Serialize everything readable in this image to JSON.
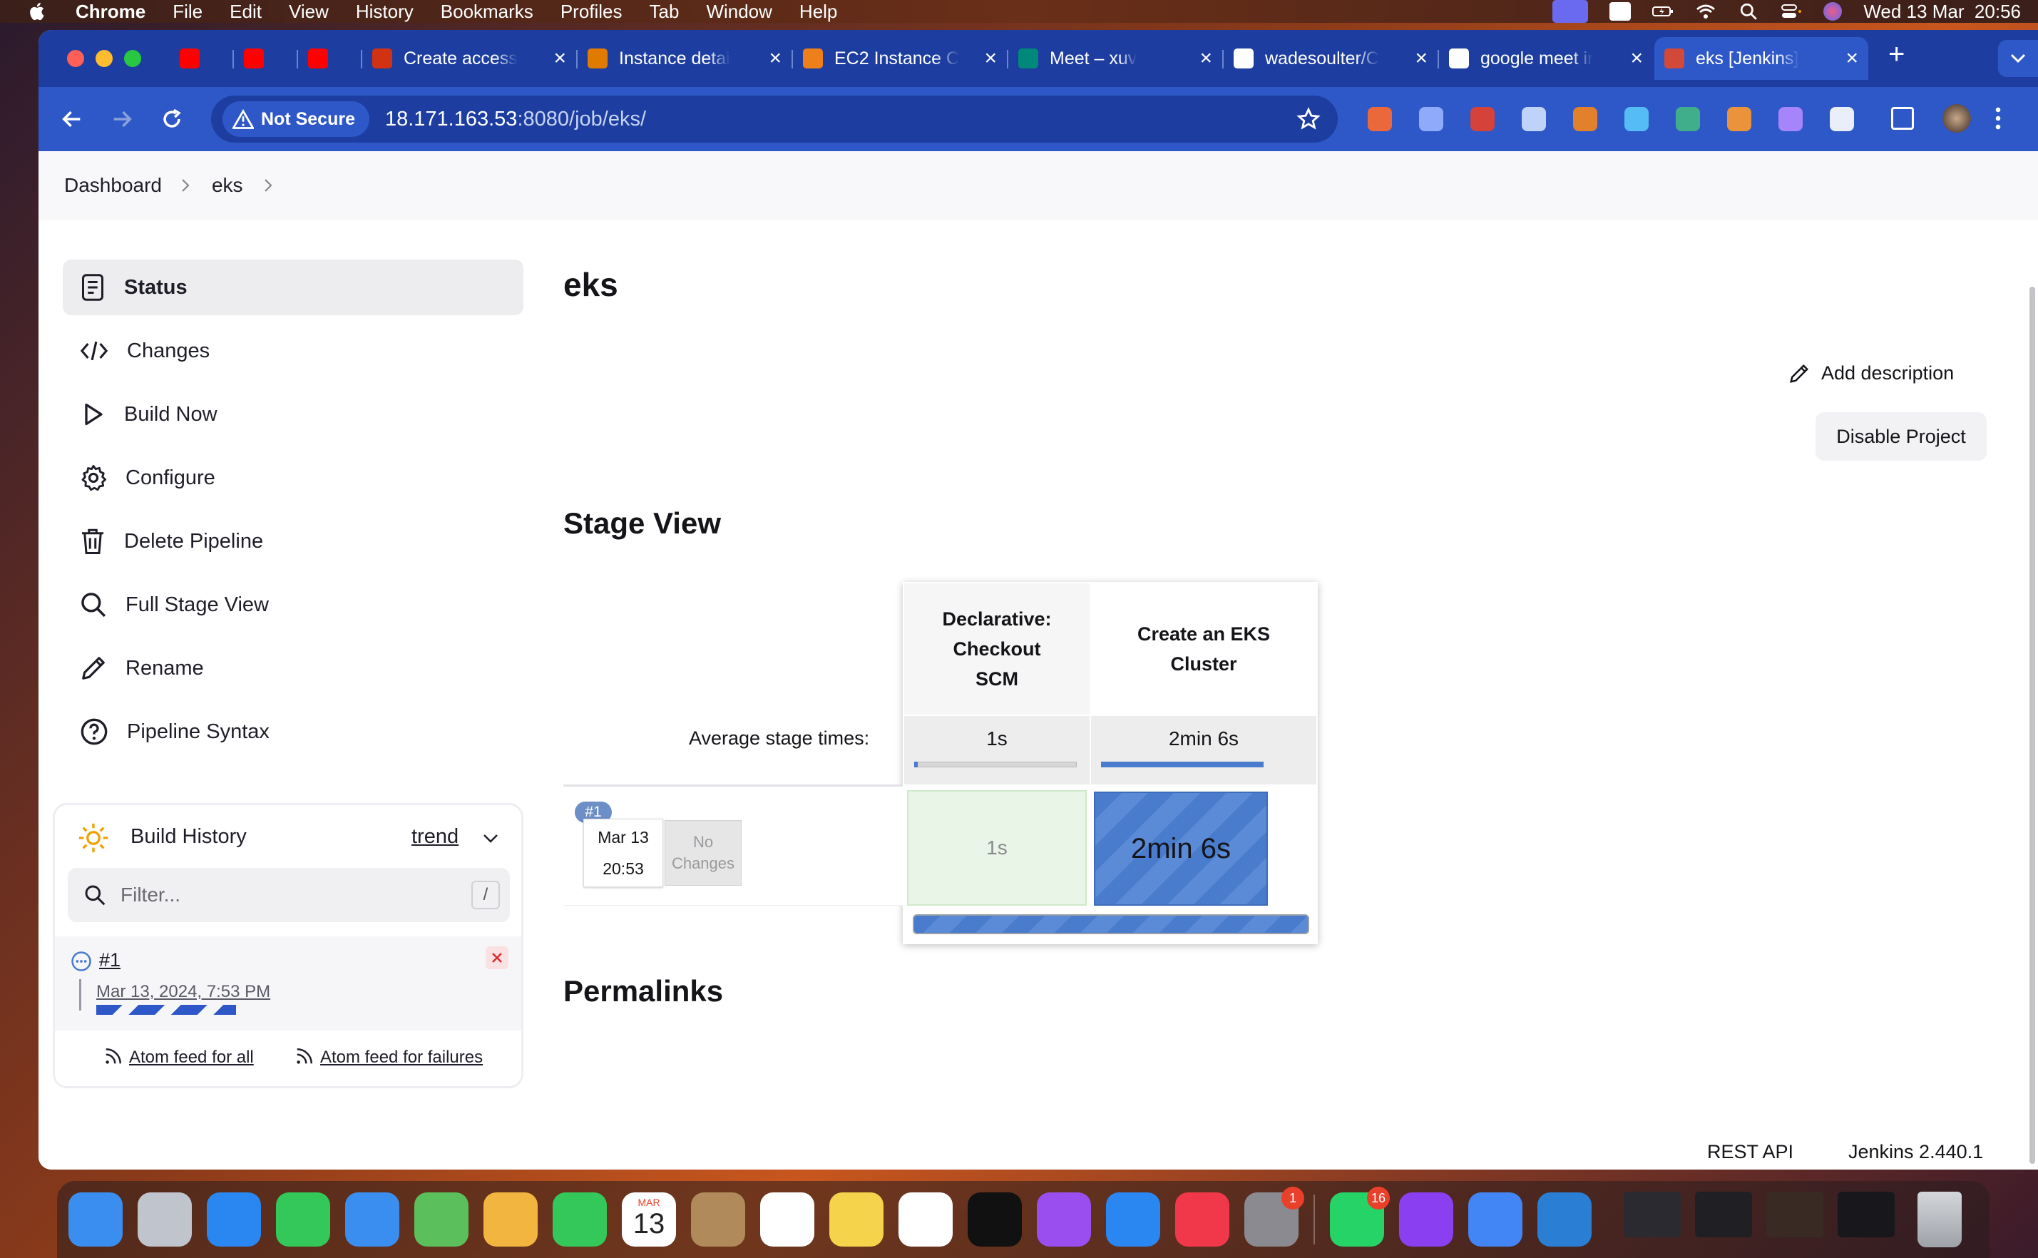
{
  "menubar": {
    "app": "Chrome",
    "items": [
      "File",
      "Edit",
      "View",
      "History",
      "Bookmarks",
      "Profiles",
      "Tab",
      "Window",
      "Help"
    ],
    "clock": "Wed 13 Mar  20:56"
  },
  "tabs": [
    {
      "title": "",
      "icon": "youtube-icon",
      "color": "#ff0000"
    },
    {
      "title": "",
      "icon": "youtube-icon",
      "color": "#ff0000"
    },
    {
      "title": "",
      "icon": "youtube-icon",
      "color": "#ff0000"
    },
    {
      "title": "Create access",
      "icon": "aws-iam-icon",
      "color": "#d13212"
    },
    {
      "title": "Instance detai",
      "icon": "aws-ec2-icon",
      "color": "#e07b00"
    },
    {
      "title": "EC2 Instance C",
      "icon": "aws-box-icon",
      "color": "#ef7f1a"
    },
    {
      "title": "Meet – xuv",
      "icon": "google-meet-icon",
      "color": "#00897b"
    },
    {
      "title": "wadesoulter/C",
      "icon": "github-icon",
      "color": "#ffffff"
    },
    {
      "title": "google meet ir",
      "icon": "google-icon",
      "color": "#ffffff"
    },
    {
      "title": "eks [Jenkins]",
      "icon": "jenkins-icon",
      "color": "#d24939"
    }
  ],
  "omnibox": {
    "security_label": "Not Secure",
    "url_host": "18.171.163.53",
    "url_rest": ":8080/job/eks/"
  },
  "breadcrumb": {
    "dashboard": "Dashboard",
    "job": "eks"
  },
  "sidebar": {
    "items": [
      {
        "label": "Status",
        "icon": "status-icon"
      },
      {
        "label": "Changes",
        "icon": "code-icon"
      },
      {
        "label": "Build Now",
        "icon": "play-icon"
      },
      {
        "label": "Configure",
        "icon": "gear-icon"
      },
      {
        "label": "Delete Pipeline",
        "icon": "trash-icon"
      },
      {
        "label": "Full Stage View",
        "icon": "search-icon"
      },
      {
        "label": "Rename",
        "icon": "pencil-icon"
      },
      {
        "label": "Pipeline Syntax",
        "icon": "help-icon"
      }
    ]
  },
  "build_history": {
    "title": "Build History",
    "trend": "trend",
    "filter_placeholder": "Filter...",
    "filter_shortcut": "/",
    "builds": [
      {
        "number": "#1",
        "date": "Mar 13, 2024, 7:53 PM"
      }
    ],
    "atom_all": "Atom feed for all",
    "atom_failures": "Atom feed for failures"
  },
  "main": {
    "title": "eks",
    "add_description": "Add description",
    "disable_project": "Disable Project",
    "stage_view_title": "Stage View",
    "permalinks_title": "Permalinks",
    "avg_label": "Average stage times:"
  },
  "stage_view": {
    "stages": [
      {
        "name_lines": [
          "Declarative:",
          "Checkout",
          "SCM"
        ],
        "avg": "1s",
        "avg_progress": 0.02,
        "run_time": "1s",
        "status": "success"
      },
      {
        "name_lines": [
          "Create an EKS",
          "Cluster"
        ],
        "avg": "2min 6s",
        "avg_progress": 1.0,
        "run_time": "2min 6s",
        "status": "in-progress"
      }
    ],
    "runs": [
      {
        "badge": "#1",
        "date": "Mar 13",
        "time": "20:53",
        "changes_lines": [
          "No",
          "Changes"
        ]
      }
    ]
  },
  "footer": {
    "rest_api": "REST API",
    "version": "Jenkins 2.440.1"
  },
  "colors": {
    "accent": "#2e58c8",
    "tabbar": "#1d3ea0",
    "progress": "#4a7ccd",
    "success_bg": "#e9f6e7"
  },
  "dock": {
    "apps": [
      {
        "name": "finder-icon",
        "color": "#3a8ef0"
      },
      {
        "name": "launchpad-icon",
        "color": "#c0c4cc"
      },
      {
        "name": "safari-icon",
        "color": "#2a86f0"
      },
      {
        "name": "messages-icon",
        "color": "#34c759"
      },
      {
        "name": "mail-icon",
        "color": "#3a8ef0"
      },
      {
        "name": "maps-icon",
        "color": "#5bbf5b"
      },
      {
        "name": "photos-icon",
        "color": "#f2b540"
      },
      {
        "name": "facetime-icon",
        "color": "#34c759"
      },
      {
        "name": "calendar-icon",
        "color": "#ffffff"
      },
      {
        "name": "contacts-icon",
        "color": "#b08a5a"
      },
      {
        "name": "reminders-icon",
        "color": "#ffffff"
      },
      {
        "name": "notes-icon",
        "color": "#f5d34a"
      },
      {
        "name": "freeform-icon",
        "color": "#ffffff"
      },
      {
        "name": "appletv-icon",
        "color": "#111111"
      },
      {
        "name": "podcasts-icon",
        "color": "#9b4ef0"
      },
      {
        "name": "appstore-icon",
        "color": "#2a86f0"
      },
      {
        "name": "music-icon",
        "color": "#f0384a"
      },
      {
        "name": "settings-icon",
        "color": "#8a8a90"
      },
      {
        "name": "whatsapp-icon",
        "color": "#25d366"
      },
      {
        "name": "wps-icon",
        "color": "#8a3ff0"
      },
      {
        "name": "chrome-icon",
        "color": "#4285f4"
      },
      {
        "name": "vscode-icon",
        "color": "#2a7fd4"
      }
    ],
    "calendar_month": "MAR",
    "calendar_day": "13",
    "badges": {
      "settings": "1",
      "whatsapp": "16"
    }
  }
}
